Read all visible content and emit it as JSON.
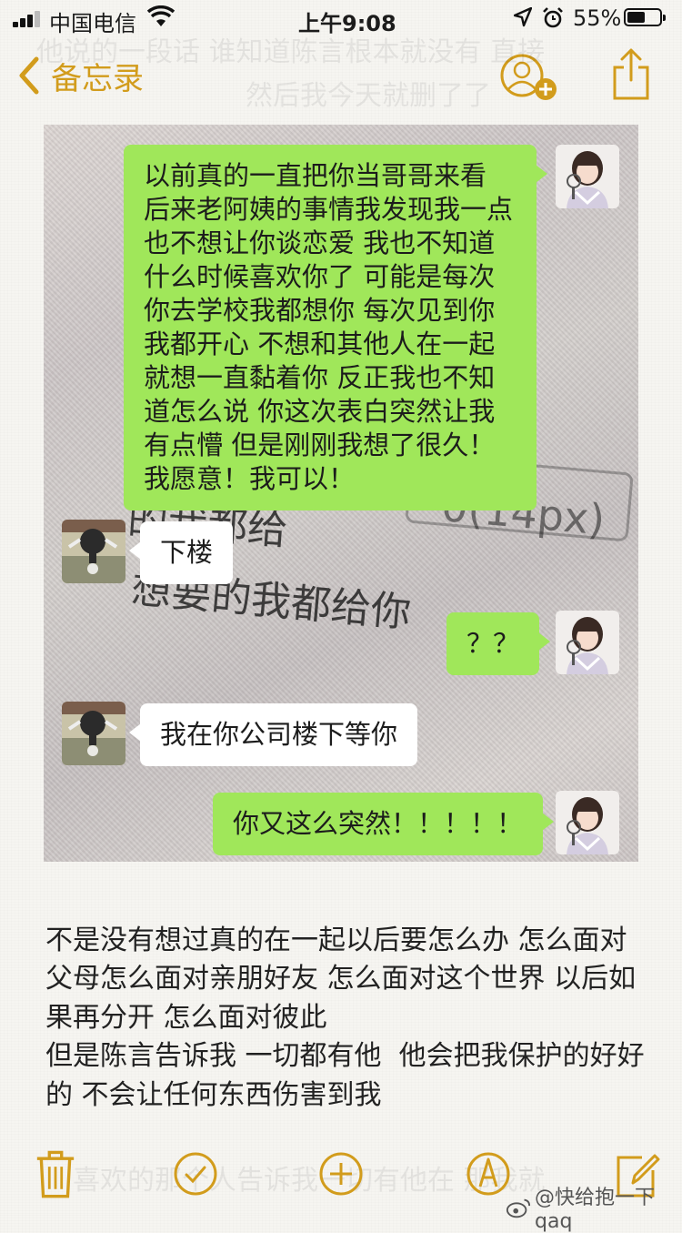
{
  "status_bar": {
    "carrier": "中国电信",
    "time": "上午9:08",
    "battery_percent": "55%",
    "battery_level": 0.55
  },
  "nav": {
    "back_label": "备忘录",
    "accent_color": "#d29c1c"
  },
  "chat": {
    "messages": [
      {
        "sender": "me",
        "text": "以前真的一直把你当哥哥来看 后来老阿姨的事情我发现我一点也不想让你谈恋爱 我也不知道什么时候喜欢你了 可能是每次你去学校我都想你 每次见到你我都开心 不想和其他人在一起 就想一直黏着你  反正我也不知道怎么说 你这次表白突然让我有点懵 但是刚刚我想了很久！我愿意！我可以！"
      },
      {
        "sender": "them",
        "text": "下楼"
      },
      {
        "sender": "me",
        "text": "？？"
      },
      {
        "sender": "them",
        "text": "我在你公司楼下等你"
      },
      {
        "sender": "me",
        "text": "你又这么突然！！！！！"
      }
    ],
    "background_text": [
      "的我都给",
      "想要的我都给你",
      "0(14px)"
    ],
    "me_bubble_color": "#a0e75a",
    "them_bubble_color": "#ffffff"
  },
  "note": {
    "body": "不是没有想过真的在一起以后要怎么办 怎么面对父母怎么面对亲朋好友 怎么面对这个世界 以后如果再分开 怎么面对彼此\n但是陈言告诉我 一切都有他  他会把我保护的好好的 不会让任何东西伤害到我"
  },
  "toolbar": {
    "icons": [
      "trash-icon",
      "checklist-icon",
      "add-icon",
      "sketch-icon",
      "compose-icon"
    ]
  },
  "watermark": {
    "text": "@快给抱一下qaq"
  }
}
